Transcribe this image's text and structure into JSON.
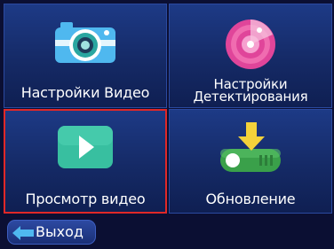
{
  "menu": {
    "items": [
      {
        "label": "Настройки Видео",
        "icon": "camera-icon",
        "selected": false
      },
      {
        "label_line1": "Настройки",
        "label_line2": "Детектирования",
        "icon": "motion-radar-icon",
        "selected": false
      },
      {
        "label": "Просмотр видео",
        "icon": "play-icon",
        "selected": true
      },
      {
        "label": "Обновление",
        "icon": "update-toggle-icon",
        "selected": false
      }
    ]
  },
  "footer": {
    "back_label": "Выход",
    "back_icon": "arrow-left-icon"
  },
  "colors": {
    "tile": "#1d3a86",
    "background": "#0b0f33",
    "selection": "#e02828",
    "accent_teal": "#38bfa0",
    "accent_blue": "#4fb8ef",
    "accent_green": "#3aa04a"
  }
}
